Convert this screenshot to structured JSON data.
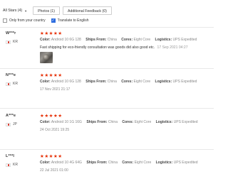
{
  "filters": {
    "stars_dropdown": "All Stars (4)",
    "photos_button": "Photos (1)",
    "feedback_button": "Additional Feedback (0)"
  },
  "options": {
    "only_country_label": "Only from your country",
    "only_country_checked": false,
    "translate_label": "Translate to English",
    "translate_checked": true
  },
  "labels": {
    "color": "Color:",
    "ships_from": "Ships From:",
    "cores": "Cores:",
    "logistics": "Logistics:"
  },
  "reviews": [
    {
      "user": "W***r",
      "country": "KR",
      "stars": "★★★★★",
      "color": "Android 10 6G 128",
      "ships_from": "China",
      "cores": "Eight Core",
      "logistics": "UPS Expedited",
      "text": "Fast shipping for eco-friendly consultation was goods did also good etc.",
      "date": "17 Sep 2021 04:27",
      "has_photo": true
    },
    {
      "user": "N***e",
      "country": "KR",
      "stars": "★★★★★",
      "color": "Android 10 6G 128",
      "ships_from": "China",
      "cores": "Eight Core",
      "logistics": "UPS Expedited",
      "date": "17 Nov 2021 21:17"
    },
    {
      "user": "A***e",
      "country": "JP",
      "stars": "★★★★★",
      "color": "Android 10 1G 16G",
      "ships_from": "China",
      "cores": "Eight Core",
      "logistics": "UPS Expedited",
      "date": "24 Oct 2021 19:25"
    },
    {
      "user": "L***l",
      "country": "KR",
      "stars": "★★★★★",
      "color": "Android 10 4G 64G",
      "ships_from": "China",
      "cores": "Eight Core",
      "logistics": "UPS Expedited",
      "date": "22 Jul 2021 01:00"
    }
  ]
}
